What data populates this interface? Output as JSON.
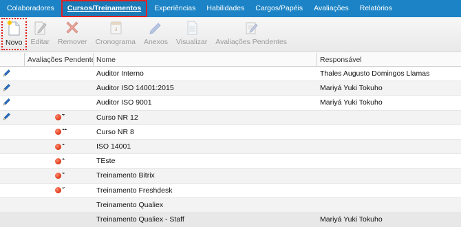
{
  "nav": {
    "tabs": [
      {
        "label": "Colaboradores"
      },
      {
        "label": "Cursos/Treinamentos"
      },
      {
        "label": "Experiências"
      },
      {
        "label": "Habilidades"
      },
      {
        "label": "Cargos/Papéis"
      },
      {
        "label": "Avaliações"
      },
      {
        "label": "Relatórios"
      }
    ],
    "active_tab": "Cursos/Treinamentos"
  },
  "toolbar": {
    "novo": "Novo",
    "editar": "Editar",
    "remover": "Remover",
    "cronograma": "Cronograma",
    "anexos": "Anexos",
    "visualizar": "Visualizar",
    "avaliacoes_pendentes": "Avaliações Pendentes"
  },
  "table": {
    "columns": [
      "",
      "Avaliações Pendentes",
      "Nome",
      "Responsável"
    ],
    "rows": [
      {
        "edit": true,
        "pending": "",
        "nome": "Auditor Interno",
        "responsavel": "Thales Augusto Domingos Llamas"
      },
      {
        "edit": true,
        "pending": "",
        "nome": "Auditor ISO 14001:2015",
        "responsavel": "Mariyá Yuki Tokuho"
      },
      {
        "edit": true,
        "pending": "",
        "nome": "Auditor ISO 9001",
        "responsavel": "Mariyá Yuki Tokuho"
      },
      {
        "edit": true,
        "pending": "4",
        "nome": "Curso NR 12",
        "responsavel": ""
      },
      {
        "edit": false,
        "pending": "11",
        "nome": "Curso NR 8",
        "responsavel": ""
      },
      {
        "edit": false,
        "pending": "1",
        "nome": "ISO 14001",
        "responsavel": ""
      },
      {
        "edit": false,
        "pending": "1",
        "nome": "TEste",
        "responsavel": ""
      },
      {
        "edit": false,
        "pending": "4",
        "nome": "Treinamento Bitrix",
        "responsavel": ""
      },
      {
        "edit": false,
        "pending": "5",
        "nome": "Treinamento Freshdesk",
        "responsavel": ""
      },
      {
        "edit": false,
        "pending": "",
        "nome": "Treinamento Qualiex",
        "responsavel": ""
      },
      {
        "edit": false,
        "pending": "",
        "nome": "Treinamento Qualiex - Staff",
        "responsavel": "Mariyá Yuki Tokuho"
      }
    ]
  },
  "colors": {
    "nav_bg": "#1c84c6",
    "active_outline": "#e02020",
    "pending_dot": "#e0401e",
    "edit_pencil": "#2b6fc4"
  }
}
